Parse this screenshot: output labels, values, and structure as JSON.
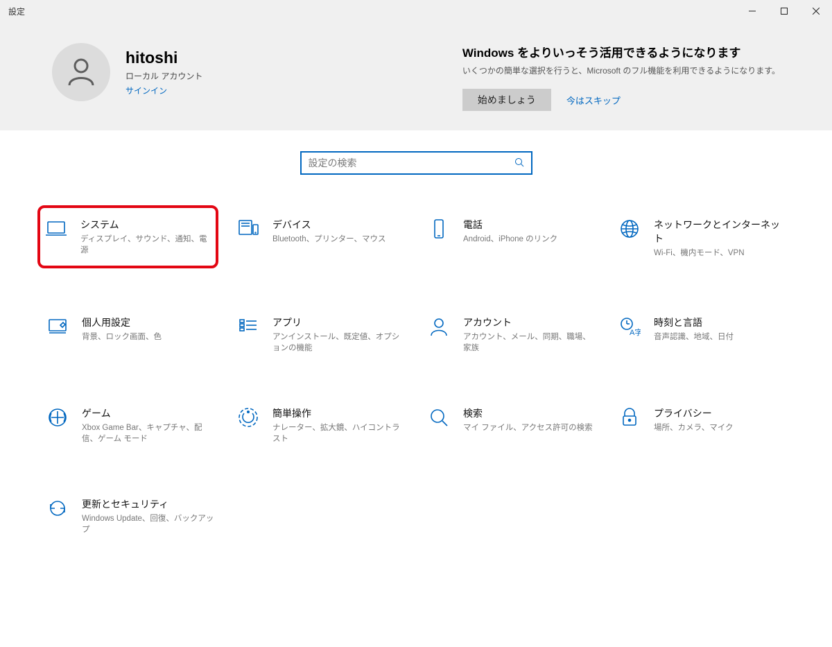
{
  "window": {
    "title": "設定"
  },
  "header": {
    "profile": {
      "name": "hitoshi",
      "account_type": "ローカル アカウント",
      "signin": "サインイン"
    },
    "promo": {
      "title": "Windows をよりいっそう活用できるようになります",
      "subtitle": "いくつかの簡単な選択を行うと、Microsoft のフル機能を利用できるようになります。",
      "start_btn": "始めましょう",
      "skip": "今はスキップ"
    }
  },
  "search": {
    "placeholder": "設定の検索"
  },
  "categories": [
    {
      "title": "システム",
      "sub": "ディスプレイ、サウンド、通知、電源",
      "icon": "laptop",
      "highlighted": true
    },
    {
      "title": "デバイス",
      "sub": "Bluetooth、プリンター、マウス",
      "icon": "devices"
    },
    {
      "title": "電話",
      "sub": "Android、iPhone のリンク",
      "icon": "phone"
    },
    {
      "title": "ネットワークとインターネット",
      "sub": "Wi-Fi、機内モード、VPN",
      "icon": "globe"
    },
    {
      "title": "個人用設定",
      "sub": "背景、ロック画面、色",
      "icon": "personalize"
    },
    {
      "title": "アプリ",
      "sub": "アンインストール、既定値、オプションの機能",
      "icon": "apps"
    },
    {
      "title": "アカウント",
      "sub": "アカウント、メール、同期、職場、家族",
      "icon": "account"
    },
    {
      "title": "時刻と言語",
      "sub": "音声認識、地域、日付",
      "icon": "time-lang"
    },
    {
      "title": "ゲーム",
      "sub": "Xbox Game Bar、キャプチャ、配信、ゲーム モード",
      "icon": "game"
    },
    {
      "title": "簡単操作",
      "sub": "ナレーター、拡大鏡、ハイコントラスト",
      "icon": "accessibility"
    },
    {
      "title": "検索",
      "sub": "マイ ファイル、アクセス許可の検索",
      "icon": "search"
    },
    {
      "title": "プライバシー",
      "sub": "場所、カメラ、マイク",
      "icon": "privacy"
    },
    {
      "title": "更新とセキュリティ",
      "sub": "Windows Update、回復、バックアップ",
      "icon": "update"
    }
  ]
}
